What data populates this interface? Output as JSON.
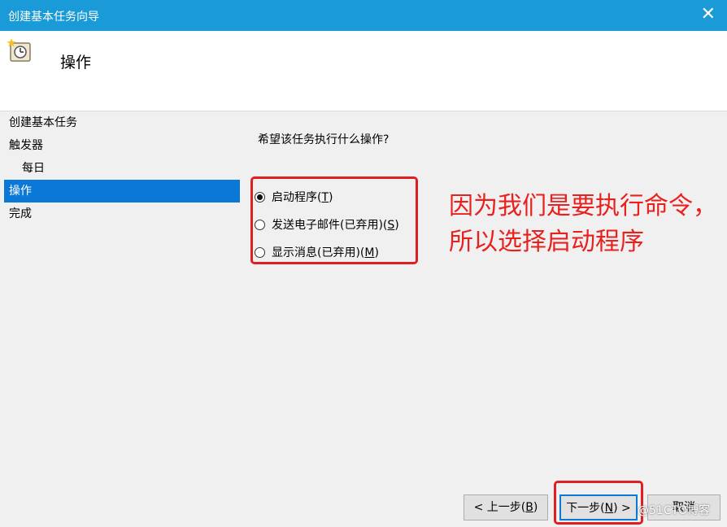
{
  "window": {
    "title": "创建基本任务向导"
  },
  "header": {
    "title": "操作"
  },
  "nav": {
    "items": [
      {
        "label": "创建基本任务"
      },
      {
        "label": "触发器"
      },
      {
        "label": "每日"
      },
      {
        "label": "操作"
      },
      {
        "label": "完成"
      }
    ]
  },
  "main": {
    "question": "希望该任务执行什么操作?",
    "options": [
      {
        "text": "启动程序(",
        "key": "T",
        "end": ")"
      },
      {
        "text": "发送电子邮件(已弃用)(",
        "key": "S",
        "end": ")"
      },
      {
        "text": "显示消息(已弃用)(",
        "key": "M",
        "end": ")"
      }
    ]
  },
  "annotation": {
    "text": "因为我们是要执行命令，所以选择启动程序"
  },
  "buttons": {
    "back": {
      "pre": "< 上一步(",
      "key": "B",
      "end": ")"
    },
    "next": {
      "pre": "下一步(",
      "key": "N",
      "end": ") >"
    },
    "cancel": "取消"
  },
  "watermark": "@51CTO博客",
  "colors": {
    "titlebar": "#1a9ad6",
    "selection": "#0a78d7",
    "annotation": "#e8211f"
  }
}
